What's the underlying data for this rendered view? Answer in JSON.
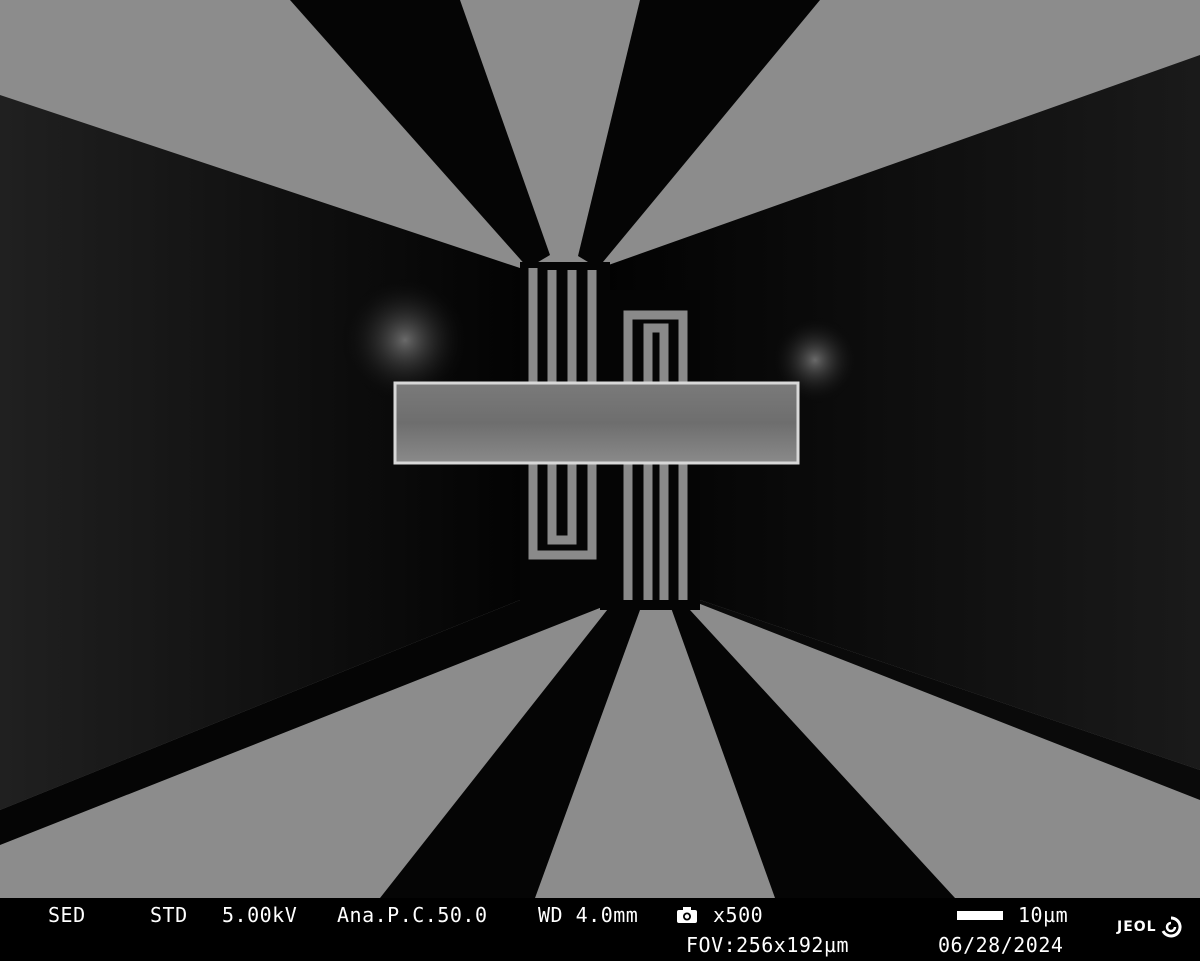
{
  "image": {
    "colors": {
      "background": "#000000",
      "substrate": "#8c8c8c",
      "gap": "#050505",
      "sample": "#b4b4b4",
      "text": "#ffffff"
    }
  },
  "infobar": {
    "detector": "SED",
    "mode": "STD",
    "voltage": "5.00kV",
    "setting": "Ana.P.C.50.0",
    "working_distance": "WD 4.0mm",
    "magnification": "x500",
    "scale_label": "10µm",
    "fov": "FOV:256x192µm",
    "date": "06/28/2024",
    "logo": "JEOL",
    "icons": {
      "camera": "camera-icon",
      "logo": "jeol-logo-icon"
    }
  }
}
